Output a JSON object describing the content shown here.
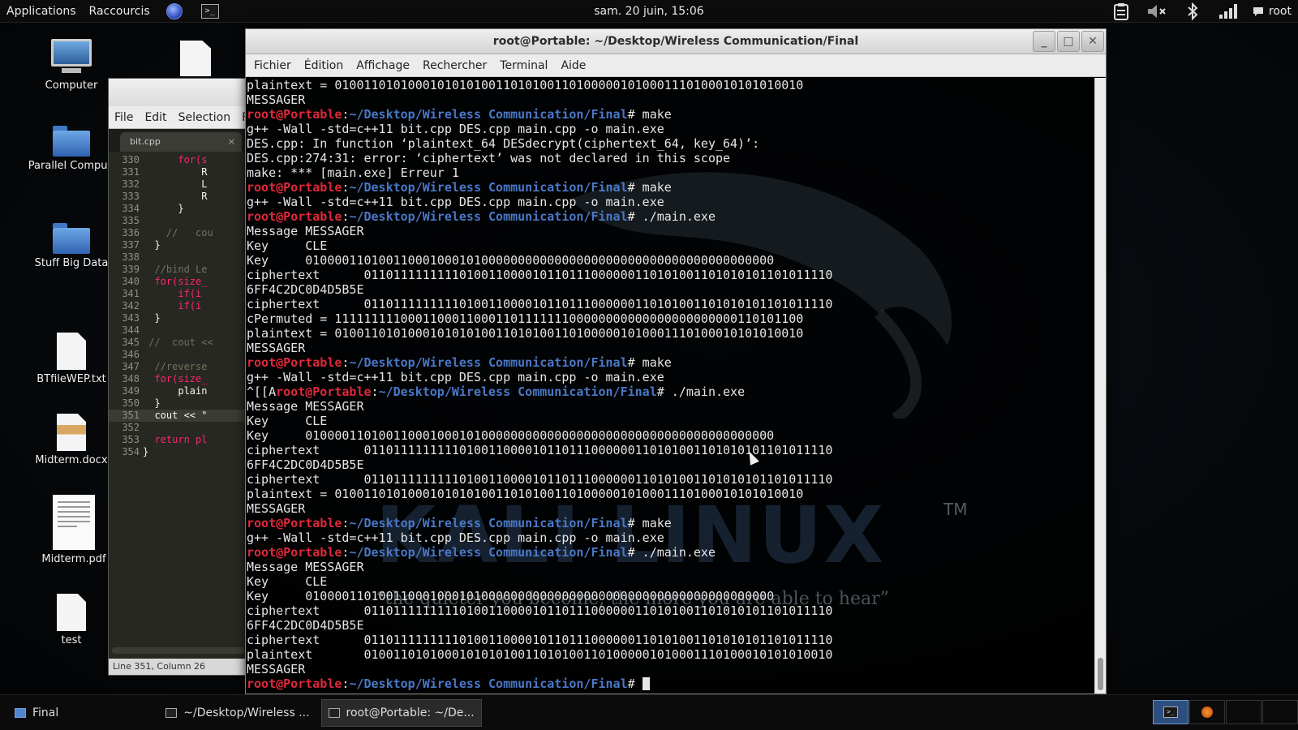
{
  "top_panel": {
    "applications": "Applications",
    "shortcuts": "Raccourcis",
    "clock": "sam. 20 juin, 15:06",
    "user": "root",
    "icons": [
      "clipboard-icon",
      "volume-muted-icon",
      "bluetooth-icon",
      "network-signal-icon",
      "chat-icon"
    ]
  },
  "desktop_icons": [
    {
      "label": "Computer",
      "icon": "computer-icon"
    },
    {
      "label": "Parallel Computi",
      "icon": "folder-icon"
    },
    {
      "label": "Stuff Big Data",
      "icon": "folder-icon"
    },
    {
      "label": "BTfileWEP.txt",
      "icon": "text-file-icon"
    },
    {
      "label": "Midterm.docx",
      "icon": "document-icon"
    },
    {
      "label": "Midterm.pdf",
      "icon": "pdf-icon"
    },
    {
      "label": "test",
      "icon": "text-file-icon"
    }
  ],
  "editor": {
    "menu": [
      "File",
      "Edit",
      "Selection",
      "F"
    ],
    "tab_label": "bit.cpp",
    "tab_close": "×",
    "status": "Line 351, Column 26",
    "lines": [
      {
        "n": "330",
        "text": "      for(s",
        "cls": "kw"
      },
      {
        "n": "331",
        "text": "          R",
        "cls": ""
      },
      {
        "n": "332",
        "text": "          L",
        "cls": ""
      },
      {
        "n": "333",
        "text": "          R",
        "cls": ""
      },
      {
        "n": "334",
        "text": "      }",
        "cls": ""
      },
      {
        "n": "335",
        "text": "",
        "cls": ""
      },
      {
        "n": "336",
        "text": "    //   cou",
        "cls": "cm"
      },
      {
        "n": "337",
        "text": "  }",
        "cls": ""
      },
      {
        "n": "338",
        "text": "",
        "cls": ""
      },
      {
        "n": "339",
        "text": "  //bind Le",
        "cls": "cm"
      },
      {
        "n": "340",
        "text": "  for(size_",
        "cls": "kw"
      },
      {
        "n": "341",
        "text": "      if(i",
        "cls": "kw"
      },
      {
        "n": "342",
        "text": "      if(i",
        "cls": "kw"
      },
      {
        "n": "343",
        "text": "  }",
        "cls": ""
      },
      {
        "n": "344",
        "text": "",
        "cls": ""
      },
      {
        "n": "345",
        "text": " //  cout <<",
        "cls": "cm"
      },
      {
        "n": "346",
        "text": "",
        "cls": ""
      },
      {
        "n": "347",
        "text": "  //reverse",
        "cls": "cm"
      },
      {
        "n": "348",
        "text": "  for(size_",
        "cls": "kw"
      },
      {
        "n": "349",
        "text": "      plain",
        "cls": ""
      },
      {
        "n": "350",
        "text": "  }",
        "cls": ""
      },
      {
        "n": "351",
        "text": "  cout << \"",
        "cls": "",
        "hl": true
      },
      {
        "n": "352",
        "text": "",
        "cls": ""
      },
      {
        "n": "353",
        "text": "  return pl",
        "cls": "kw"
      },
      {
        "n": "354",
        "text": "}",
        "cls": ""
      }
    ]
  },
  "terminal": {
    "title": "root@Portable: ~/Desktop/Wireless Communication/Final",
    "window_buttons": {
      "minimize": "_",
      "maximize": "□",
      "close": "✕"
    },
    "menu": [
      "Fichier",
      "Édition",
      "Affichage",
      "Rechercher",
      "Terminal",
      "Aide"
    ],
    "prompt_user": "root@Portable",
    "prompt_sep": ":",
    "prompt_path": "~/Desktop/Wireless Communication/Final",
    "prompt_end": "# ",
    "lines": [
      {
        "t": "plaintext = 0100110101000101010100110101001101000001010001110100010101010010"
      },
      {
        "t": "MESSAGER"
      },
      {
        "p": true,
        "cmd": "make"
      },
      {
        "t": "g++ -Wall -std=c++11 bit.cpp DES.cpp main.cpp -o main.exe"
      },
      {
        "t": "DES.cpp: In function ‘plaintext_64 DESdecrypt(ciphertext_64, key_64)’:"
      },
      {
        "t": "DES.cpp:274:31: error: ‘ciphertext’ was not declared in this scope"
      },
      {
        "t": "make: *** [main.exe] Erreur 1"
      },
      {
        "p": true,
        "cmd": "make"
      },
      {
        "t": "g++ -Wall -std=c++11 bit.cpp DES.cpp main.cpp -o main.exe"
      },
      {
        "p": true,
        "cmd": "./main.exe"
      },
      {
        "t": "Message MESSAGER"
      },
      {
        "t": "Key     CLE"
      },
      {
        "t": "Key     0100001101001100010001010000000000000000000000000000000000000000"
      },
      {
        "t": "ciphertext      0110111111111010011000010110111000000110101001101010101101011110"
      },
      {
        "t": "6FF4C2DC0D4D5B5E"
      },
      {
        "t": "ciphertext      0110111111111010011000010110111000000110101001101010101101011110"
      },
      {
        "t": "cPermuted = 1111111110001100011000110111111100000000000000000000000110101100"
      },
      {
        "t": "plaintext = 0100110101000101010100110101001101000001010001110100010101010010"
      },
      {
        "t": "MESSAGER"
      },
      {
        "p": true,
        "cmd": "make"
      },
      {
        "t": "g++ -Wall -std=c++11 bit.cpp DES.cpp main.cpp -o main.exe"
      },
      {
        "pre": "^[[A",
        "p": true,
        "cmd": "./main.exe"
      },
      {
        "t": "Message MESSAGER"
      },
      {
        "t": "Key     CLE"
      },
      {
        "t": "Key     0100001101001100010001010000000000000000000000000000000000000000"
      },
      {
        "t": "ciphertext      0110111111111010011000010110111000000110101001101010101101011110"
      },
      {
        "t": "6FF4C2DC0D4D5B5E"
      },
      {
        "t": "ciphertext      0110111111111010011000010110111000000110101001101010101101011110"
      },
      {
        "t": "plaintext = 0100110101000101010100110101001101000001010001110100010101010010"
      },
      {
        "t": "MESSAGER"
      },
      {
        "p": true,
        "cmd": "make"
      },
      {
        "t": "g++ -Wall -std=c++11 bit.cpp DES.cpp main.cpp -o main.exe"
      },
      {
        "p": true,
        "cmd": "./main.exe"
      },
      {
        "t": "Message MESSAGER"
      },
      {
        "t": "Key     CLE"
      },
      {
        "t": "Key     0100001101001100010001010000000000000000000000000000000000000000"
      },
      {
        "t": "ciphertext      0110111111111010011000010110111000000110101001101010101101011110"
      },
      {
        "t": "6FF4C2DC0D4D5B5E"
      },
      {
        "t": "ciphertext      0110111111111010011000010110111000000110101001101010101101011110"
      },
      {
        "t": "plaintext       0100110101000101010100110101001101000001010001110100010101010010"
      },
      {
        "t": "MESSAGER"
      },
      {
        "p": true,
        "cmd": "",
        "cursor": true
      }
    ]
  },
  "wallpaper": {
    "logo": "KALI LINUX",
    "tm": "TM",
    "quote": "“the quieter you become, the more you are able to hear”"
  },
  "taskbar": {
    "tasks": [
      {
        "label": "Final",
        "icon": "folder-icon",
        "active": false
      },
      {
        "label": "~/Desktop/Wireless ...",
        "icon": "editor-icon",
        "active": false
      },
      {
        "label": "root@Portable: ~/De...",
        "icon": "terminal-icon",
        "active": true
      }
    ]
  },
  "colors": {
    "prompt_user": "#e0283a",
    "prompt_path": "#4a78c8",
    "terminal_text": "#e6e6e6"
  }
}
